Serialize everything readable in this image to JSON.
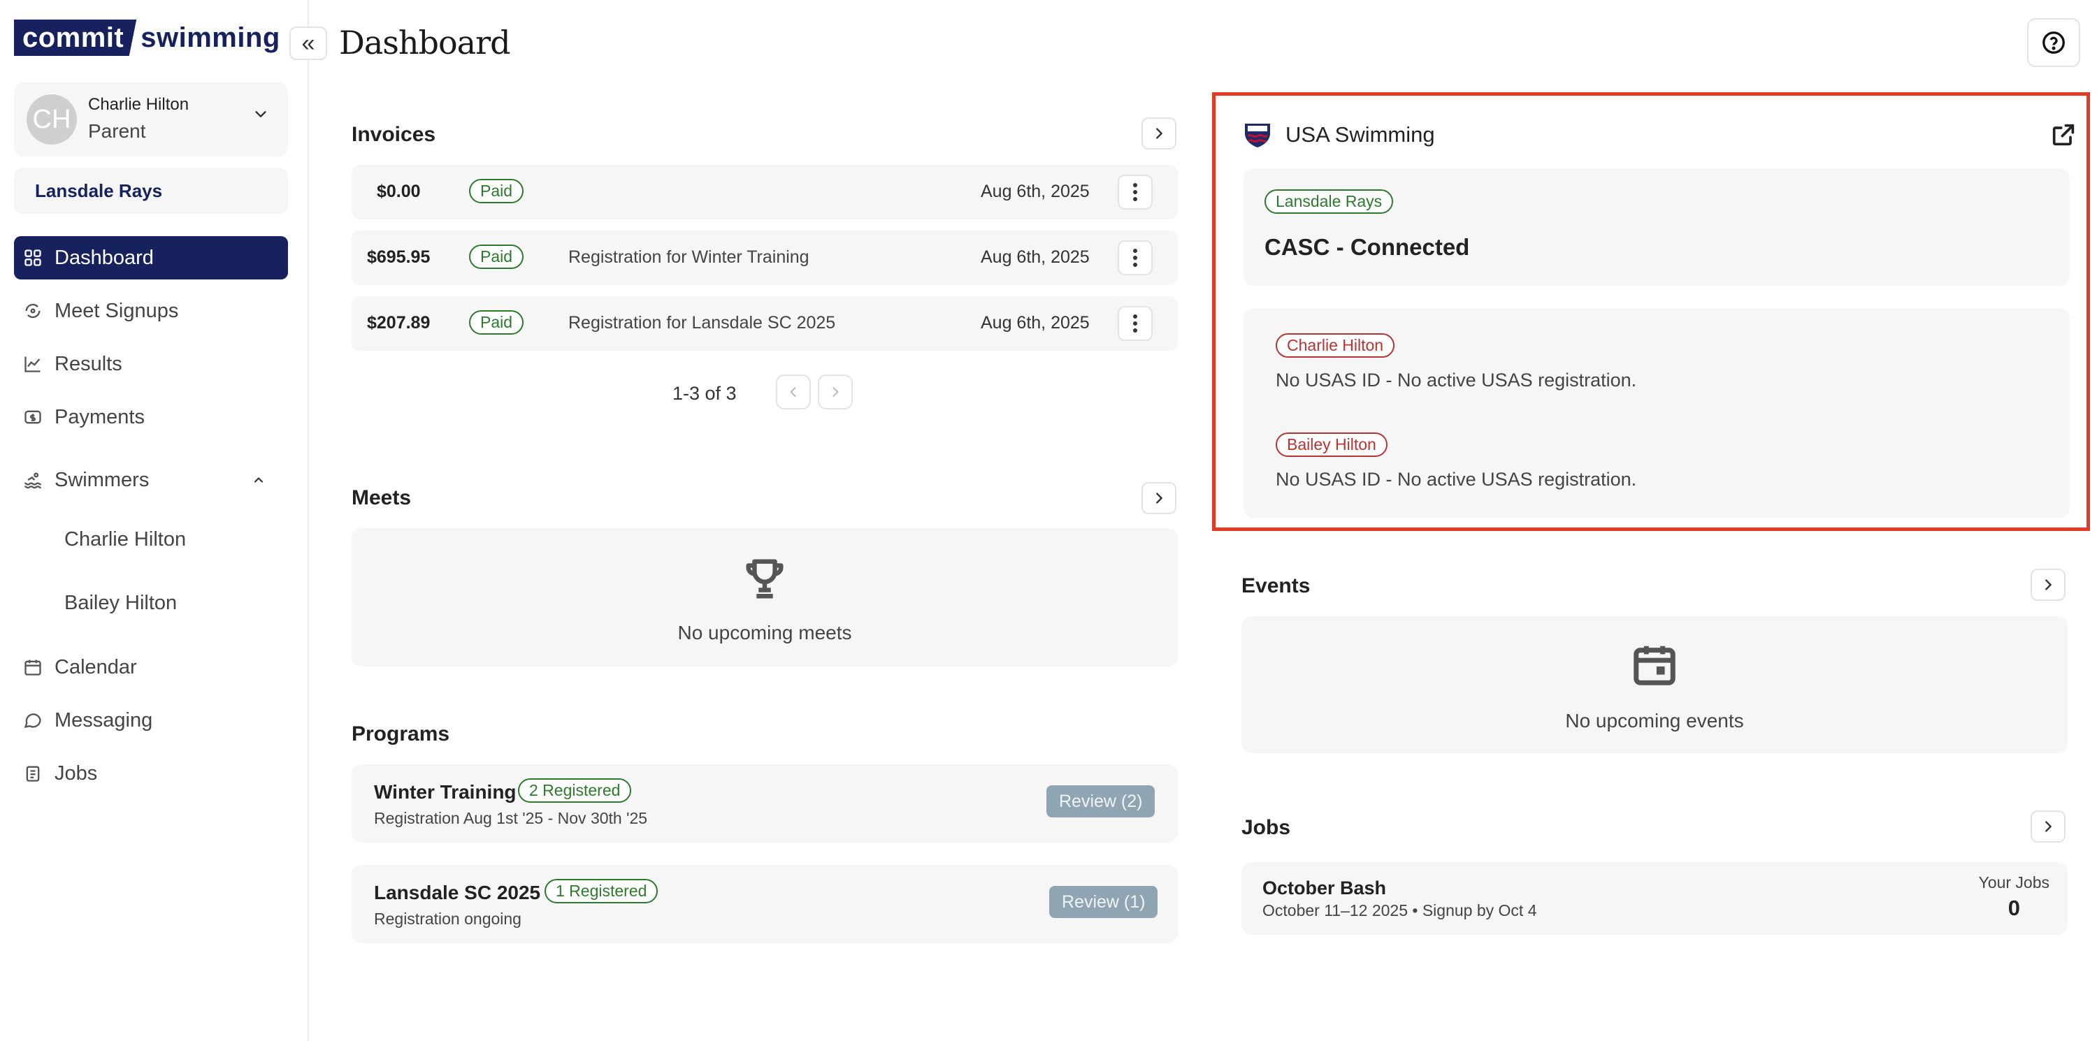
{
  "logo": {
    "part1": "commit",
    "part2": "swimming"
  },
  "user": {
    "initials": "CH",
    "name": "Charlie Hilton",
    "role": "Parent"
  },
  "team": "Lansdale Rays",
  "nav": {
    "dashboard": "Dashboard",
    "meet_signups": "Meet Signups",
    "results": "Results",
    "payments": "Payments",
    "swimmers": "Swimmers",
    "swimmer1": "Charlie Hilton",
    "swimmer2": "Bailey Hilton",
    "calendar": "Calendar",
    "messaging": "Messaging",
    "jobs": "Jobs"
  },
  "header": {
    "title": "Dashboard"
  },
  "invoices": {
    "title": "Invoices",
    "rows": [
      {
        "amount": "$0.00",
        "status": "Paid",
        "desc": "",
        "date": "Aug 6th, 2025"
      },
      {
        "amount": "$695.95",
        "status": "Paid",
        "desc": "Registration for Winter Training",
        "date": "Aug 6th, 2025"
      },
      {
        "amount": "$207.89",
        "status": "Paid",
        "desc": "Registration for Lansdale SC 2025",
        "date": "Aug 6th, 2025"
      }
    ],
    "pager": "1-3 of 3"
  },
  "meets": {
    "title": "Meets",
    "empty": "No upcoming meets"
  },
  "programs": {
    "title": "Programs",
    "rows": [
      {
        "name": "Winter Training",
        "badge": "2 Registered",
        "sub": "Registration Aug 1st '25 - Nov 30th '25",
        "review": "Review (2)"
      },
      {
        "name": "Lansdale SC 2025",
        "badge": "1 Registered",
        "sub": "Registration ongoing",
        "review": "Review (1)"
      }
    ]
  },
  "usa": {
    "title": "USA Swimming",
    "team_badge": "Lansdale Rays",
    "status": "CASC - Connected",
    "swimmers": [
      {
        "name": "Charlie Hilton",
        "info": "No USAS ID - No active USAS registration."
      },
      {
        "name": "Bailey Hilton",
        "info": "No USAS ID - No active USAS registration."
      }
    ]
  },
  "events": {
    "title": "Events",
    "empty": "No upcoming events"
  },
  "jobs": {
    "title": "Jobs",
    "item": {
      "name": "October Bash",
      "sub": "October 11–12 2025 • Signup by Oct 4",
      "your_jobs_label": "Your Jobs",
      "your_jobs_count": "0"
    }
  },
  "colors": {
    "brand": "#17215e",
    "paid": "#2c7a2c",
    "alert": "#b83333",
    "highlight": "#e23b25"
  }
}
